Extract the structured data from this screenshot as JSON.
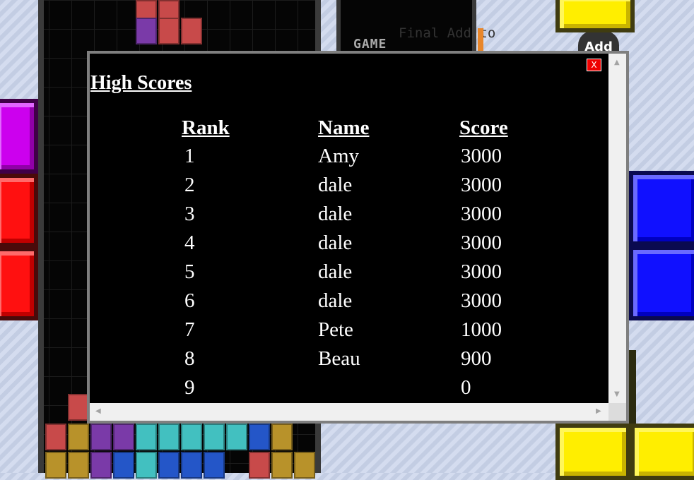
{
  "background": {
    "game_label": "GAME",
    "final_label": "Final Add to",
    "add_label": "Add"
  },
  "dialog": {
    "close_label": "X",
    "title": "High Scores",
    "columns": {
      "rank": "Rank",
      "name": "Name",
      "score": "Score"
    },
    "rows": [
      {
        "rank": "1",
        "name": "Amy",
        "score": "3000"
      },
      {
        "rank": "2",
        "name": "dale",
        "score": "3000"
      },
      {
        "rank": "3",
        "name": "dale",
        "score": "3000"
      },
      {
        "rank": "4",
        "name": "dale",
        "score": "3000"
      },
      {
        "rank": "5",
        "name": "dale",
        "score": "3000"
      },
      {
        "rank": "6",
        "name": "dale",
        "score": "3000"
      },
      {
        "rank": "7",
        "name": "Pete",
        "score": "1000"
      },
      {
        "rank": "8",
        "name": "Beau",
        "score": "900"
      },
      {
        "rank": "9",
        "name": "",
        "score": "0"
      }
    ]
  },
  "colors": {
    "close_button": "#ee0000",
    "dialog_background": "#000000",
    "dialog_border": "#7f7f7f",
    "text": "#ffffff"
  },
  "icons": {
    "up": "scroll-up-arrow-icon",
    "down": "scroll-down-arrow-icon",
    "left": "scroll-left-arrow-icon",
    "right": "scroll-right-arrow-icon"
  }
}
